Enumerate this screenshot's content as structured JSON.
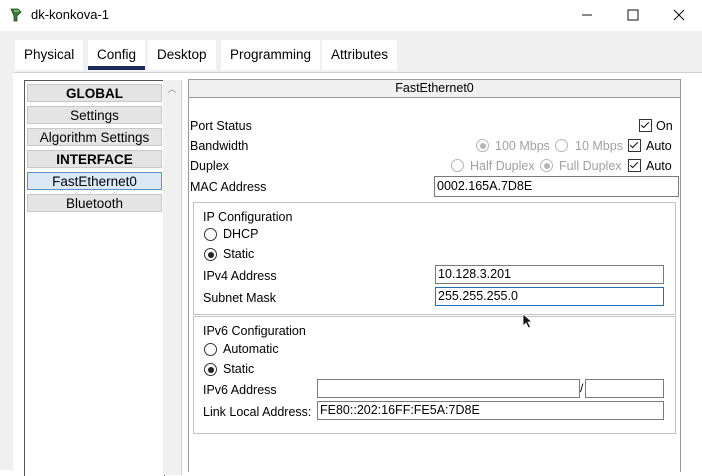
{
  "window": {
    "title": "dk-konkova-1",
    "minimize_glyph": "—",
    "maximize_glyph": "☐",
    "close_glyph": "✕"
  },
  "tabs": [
    {
      "label": "Physical"
    },
    {
      "label": "Config"
    },
    {
      "label": "Desktop"
    },
    {
      "label": "Programming"
    },
    {
      "label": "Attributes"
    }
  ],
  "active_tab": "Config",
  "sidebar": {
    "items": [
      {
        "label": "GLOBAL",
        "type": "header"
      },
      {
        "label": "Settings",
        "type": "item"
      },
      {
        "label": "Algorithm Settings",
        "type": "item"
      },
      {
        "label": "INTERFACE",
        "type": "header"
      },
      {
        "label": "FastEthernet0",
        "type": "item",
        "selected": true
      },
      {
        "label": "Bluetooth",
        "type": "item"
      }
    ]
  },
  "panel": {
    "title": "FastEthernet0",
    "port_status": {
      "label": "Port Status",
      "on_label": "On",
      "on_checked": true
    },
    "bandwidth": {
      "label": "Bandwidth",
      "opt1": "100 Mbps",
      "opt2": "10 Mbps",
      "auto_label": "Auto",
      "auto_checked": true
    },
    "duplex": {
      "label": "Duplex",
      "opt1": "Half Duplex",
      "opt2": "Full Duplex",
      "auto_label": "Auto",
      "auto_checked": true
    },
    "mac": {
      "label": "MAC Address",
      "value": "0002.165A.7D8E"
    },
    "ip_config": {
      "title": "IP Configuration",
      "dhcp_label": "DHCP",
      "static_label": "Static",
      "mode": "Static",
      "ipv4_label": "IPv4 Address",
      "ipv4_value": "10.128.3.201",
      "mask_label": "Subnet Mask",
      "mask_value": "255.255.255.0"
    },
    "ipv6_config": {
      "title": "IPv6 Configuration",
      "auto_label": "Automatic",
      "static_label": "Static",
      "mode": "Static",
      "ipv6_label": "IPv6 Address",
      "ipv6_value": "",
      "prefix_sep": "/",
      "prefix_value": "",
      "link_local_label": "Link Local Address:",
      "link_local_value": "FE80::202:16FF:FE5A:7D8E"
    }
  }
}
